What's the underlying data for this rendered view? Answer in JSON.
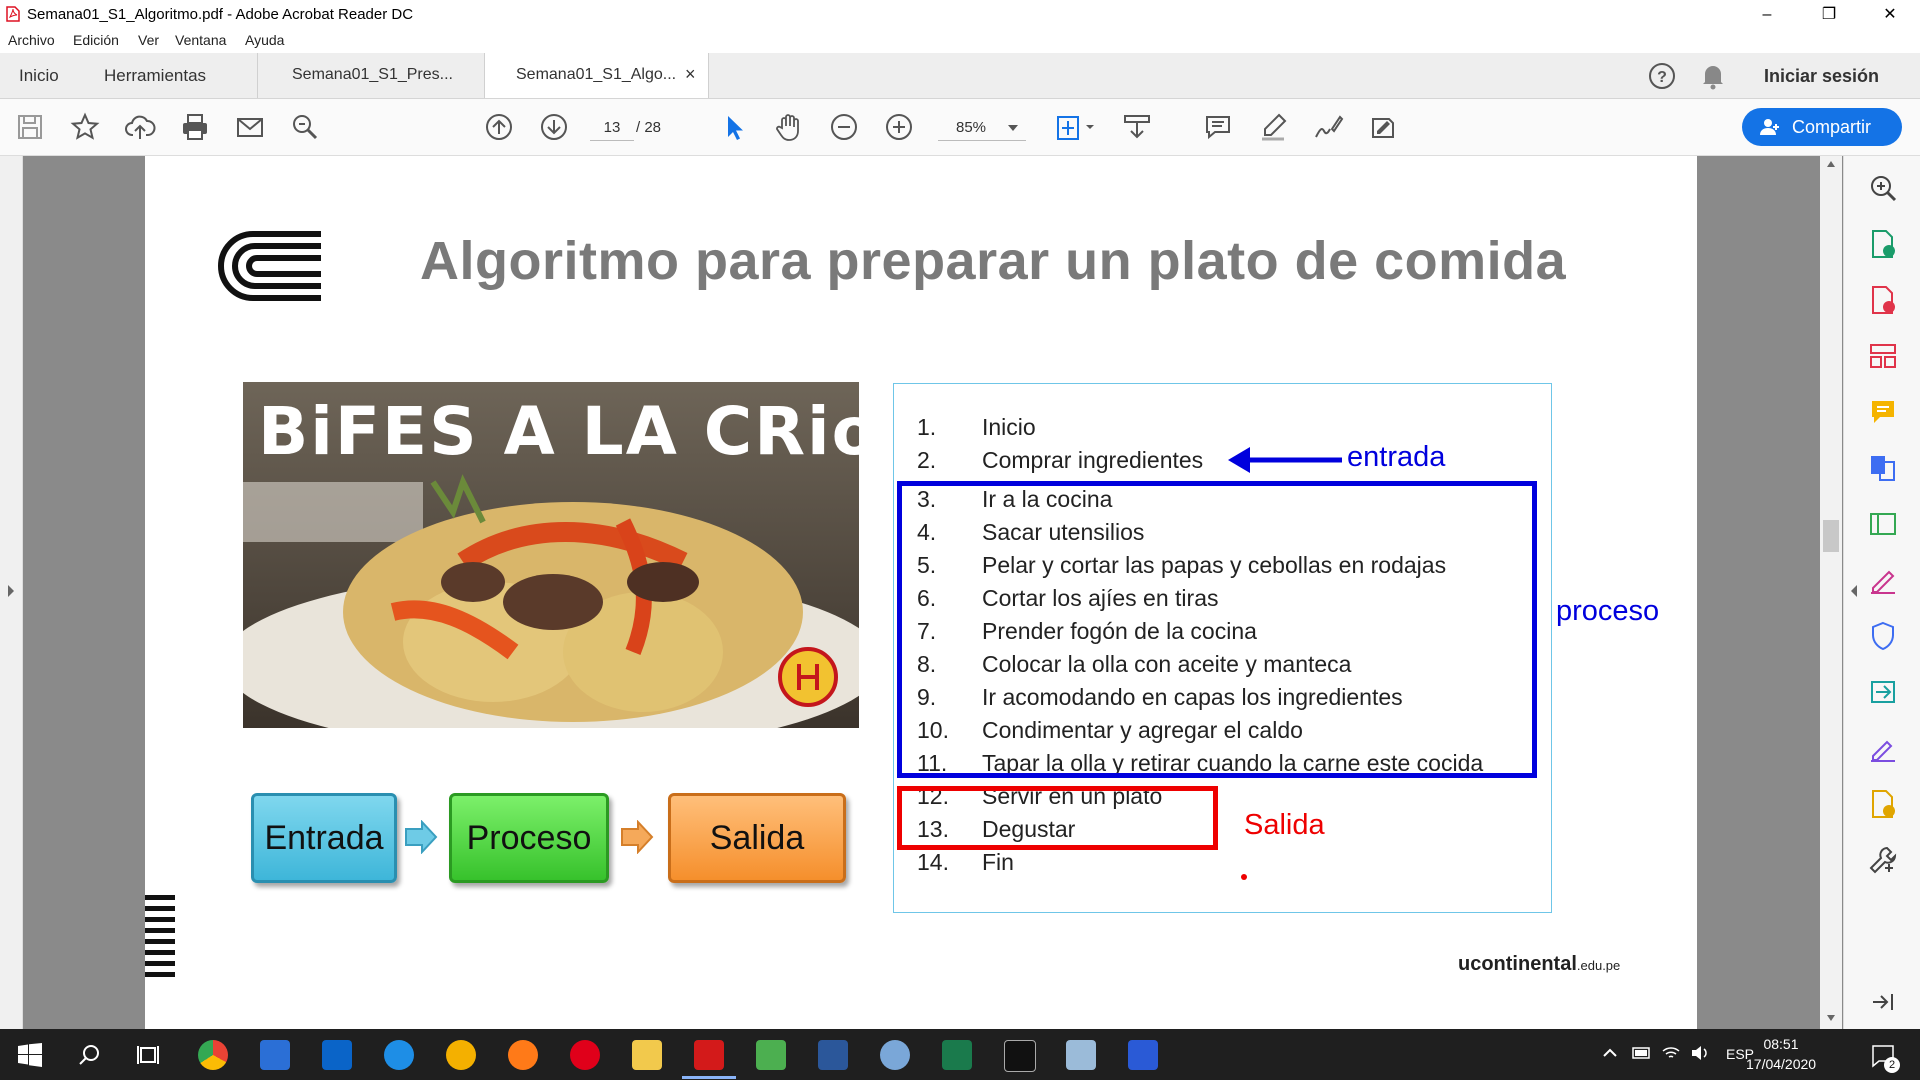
{
  "window": {
    "title": "Semana01_S1_Algoritmo.pdf - Adobe Acrobat Reader DC",
    "controls": {
      "minimize": "–",
      "restore": "❐",
      "close": "✕"
    }
  },
  "menu": [
    "Archivo",
    "Edición",
    "Ver",
    "Ventana",
    "Ayuda"
  ],
  "tabs": {
    "home": "Inicio",
    "tools": "Herramientas",
    "doc1": "Semana01_S1_Pres...",
    "doc2": "Semana01_S1_Algo...",
    "close": "×",
    "signin": "Iniciar sesión"
  },
  "toolbar": {
    "page_current": "13",
    "page_total": "/ 28",
    "zoom": "85%",
    "share": "Compartir"
  },
  "slide": {
    "title": "Algoritmo para preparar un plato de comida",
    "image_title": "BiFES A LA CRioLLA",
    "flow": [
      "Entrada",
      "Proceso",
      "Salida"
    ],
    "steps": [
      {
        "n": "1.",
        "t": "Inicio"
      },
      {
        "n": "2.",
        "t": "Comprar ingredientes"
      },
      {
        "n": "3.",
        "t": "Ir a la cocina"
      },
      {
        "n": "4.",
        "t": "Sacar utensilios"
      },
      {
        "n": "5.",
        "t": "Pelar y cortar las papas y cebollas en rodajas"
      },
      {
        "n": "6.",
        "t": "Cortar los ajíes en tiras"
      },
      {
        "n": "7.",
        "t": "Prender fogón de la cocina"
      },
      {
        "n": "8.",
        "t": "Colocar la olla con aceite y manteca"
      },
      {
        "n": "9.",
        "t": "Ir acomodando en capas los ingredientes"
      },
      {
        "n": "10.",
        "t": "Condimentar y agregar el caldo"
      },
      {
        "n": "11.",
        "t": "Tapar la olla y retirar cuando la carne este cocida"
      },
      {
        "n": "12.",
        "t": "Servir en un plato"
      },
      {
        "n": "13.",
        "t": "Degustar"
      },
      {
        "n": "14.",
        "t": "Fin"
      }
    ],
    "annotations": {
      "entrada": "entrada",
      "proceso": "proceso",
      "salida": "Salida"
    },
    "footer_brand": "ucontinental",
    "footer_domain": ".edu.pe"
  },
  "taskbar": {
    "lang": "ESP",
    "time": "08:51",
    "date": "17/04/2020",
    "notifications": "2"
  },
  "colors": {
    "accent": "#1473e6",
    "annot_blue": "#0000dd",
    "annot_red": "#ee0000"
  }
}
